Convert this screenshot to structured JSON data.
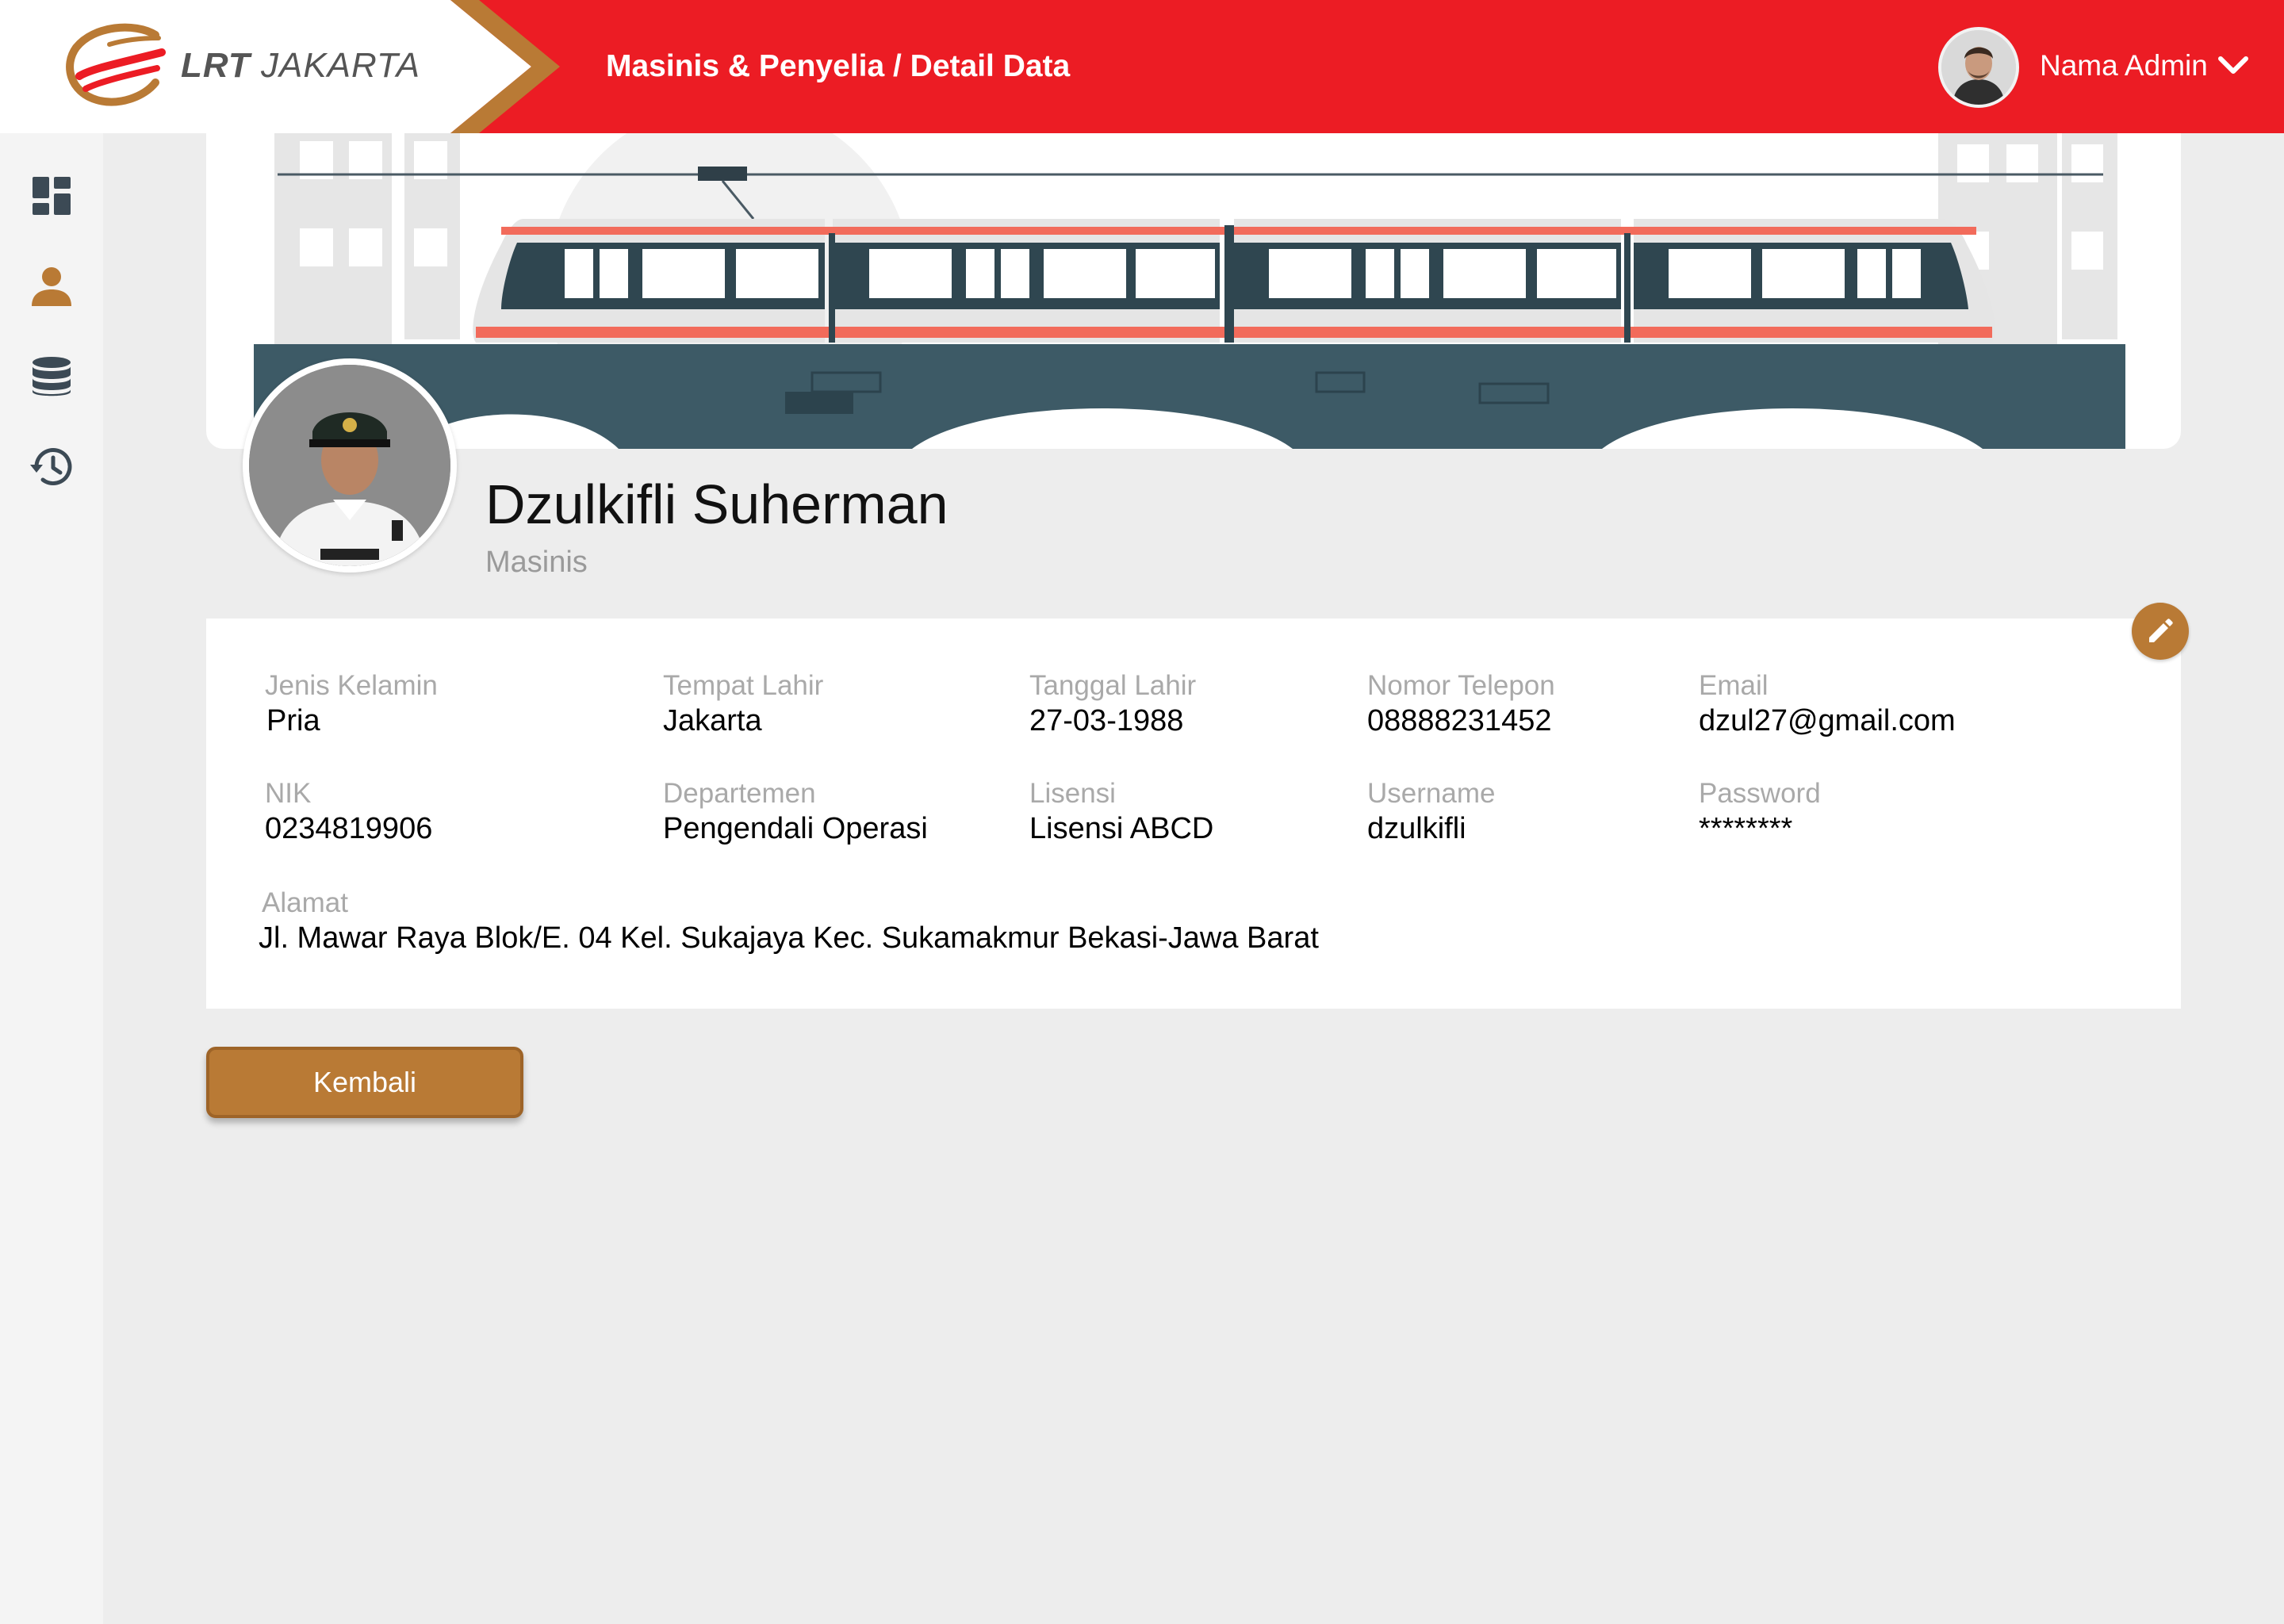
{
  "header": {
    "logo": {
      "brand_bold": "LRT",
      "brand_light": "JAKARTA"
    },
    "breadcrumb": "Masinis & Penyelia / Detail Data",
    "user": {
      "name": "Nama Admin"
    }
  },
  "sidebar": {
    "items": [
      {
        "icon": "dashboard-icon",
        "active": false
      },
      {
        "icon": "user-icon",
        "active": true
      },
      {
        "icon": "database-icon",
        "active": false
      },
      {
        "icon": "history-icon",
        "active": false
      }
    ]
  },
  "profile": {
    "name": "Dzulkifli Suherman",
    "role": "Masinis"
  },
  "details": {
    "jenis_kelamin": {
      "label": "Jenis Kelamin",
      "value": "Pria"
    },
    "tempat_lahir": {
      "label": "Tempat Lahir",
      "value": "Jakarta"
    },
    "tanggal_lahir": {
      "label": "Tanggal Lahir",
      "value": "27-03-1988"
    },
    "nomor_telepon": {
      "label": "Nomor Telepon",
      "value": "08888231452"
    },
    "email": {
      "label": "Email",
      "value": "dzul27@gmail.com"
    },
    "nik": {
      "label": "NIK",
      "value": "0234819906"
    },
    "departemen": {
      "label": "Departemen",
      "value": "Pengendali Operasi"
    },
    "lisensi": {
      "label": "Lisensi",
      "value": "Lisensi ABCD"
    },
    "username": {
      "label": "Username",
      "value": "dzulkifli"
    },
    "password": {
      "label": "Password",
      "value": "********"
    },
    "alamat": {
      "label": "Alamat",
      "value": "Jl. Mawar Raya Blok/E. 04 Kel. Sukajaya Kec. Sukamakmur  Bekasi-Jawa Barat"
    }
  },
  "actions": {
    "back_label": "Kembali"
  },
  "colors": {
    "header_red": "#ec1c24",
    "accent_gold": "#b97a35",
    "train_coral": "#f26b5b",
    "bridge_slate": "#3d5a66",
    "page_bg": "#ededed"
  }
}
